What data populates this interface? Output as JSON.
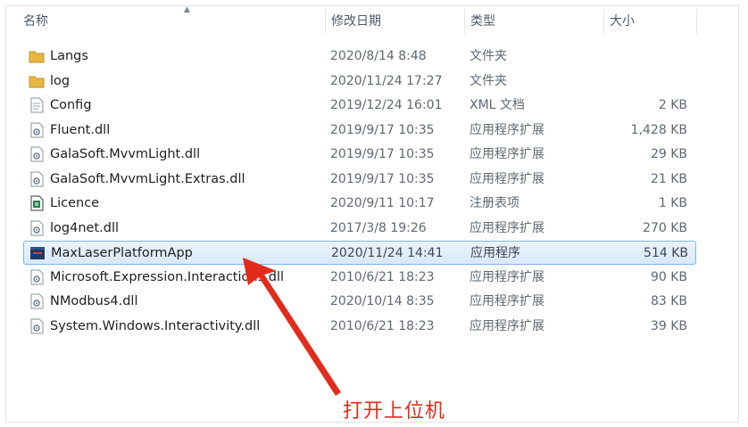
{
  "columns": {
    "name": "名称",
    "modified": "修改日期",
    "type": "类型",
    "size": "大小"
  },
  "files": [
    {
      "name": "Langs",
      "date": "2020/8/14 8:48",
      "type": "文件夹",
      "size": "",
      "icon": "folder-icon"
    },
    {
      "name": "log",
      "date": "2020/11/24 17:27",
      "type": "文件夹",
      "size": "",
      "icon": "folder-icon"
    },
    {
      "name": "Config",
      "date": "2019/12/24 16:01",
      "type": "XML 文档",
      "size": "2 KB",
      "icon": "xml-file-icon"
    },
    {
      "name": "Fluent.dll",
      "date": "2019/9/17 10:35",
      "type": "应用程序扩展",
      "size": "1,428 KB",
      "icon": "dll-file-icon"
    },
    {
      "name": "GalaSoft.MvvmLight.dll",
      "date": "2019/9/17 10:35",
      "type": "应用程序扩展",
      "size": "29 KB",
      "icon": "dll-file-icon"
    },
    {
      "name": "GalaSoft.MvvmLight.Extras.dll",
      "date": "2019/9/17 10:35",
      "type": "应用程序扩展",
      "size": "21 KB",
      "icon": "dll-file-icon"
    },
    {
      "name": "Licence",
      "date": "2020/9/11 10:17",
      "type": "注册表项",
      "size": "1 KB",
      "icon": "registry-file-icon"
    },
    {
      "name": "log4net.dll",
      "date": "2017/3/8 19:26",
      "type": "应用程序扩展",
      "size": "270 KB",
      "icon": "dll-file-icon"
    },
    {
      "name": "MaxLaserPlatformApp",
      "date": "2020/11/24 14:41",
      "type": "应用程序",
      "size": "514 KB",
      "icon": "application-icon",
      "selected": true
    },
    {
      "name": "Microsoft.Expression.Interactions.dll",
      "date": "2010/6/21 18:23",
      "type": "应用程序扩展",
      "size": "90 KB",
      "icon": "dll-file-icon"
    },
    {
      "name": "NModbus4.dll",
      "date": "2020/10/14 8:35",
      "type": "应用程序扩展",
      "size": "83 KB",
      "icon": "dll-file-icon"
    },
    {
      "name": "System.Windows.Interactivity.dll",
      "date": "2010/6/21 18:23",
      "type": "应用程序扩展",
      "size": "39 KB",
      "icon": "dll-file-icon"
    }
  ],
  "annotation": {
    "text": "打开上位机",
    "color": "#e32b1c"
  },
  "colors": {
    "selection_border": "#7eb4ea",
    "folder": "#e8b847"
  }
}
